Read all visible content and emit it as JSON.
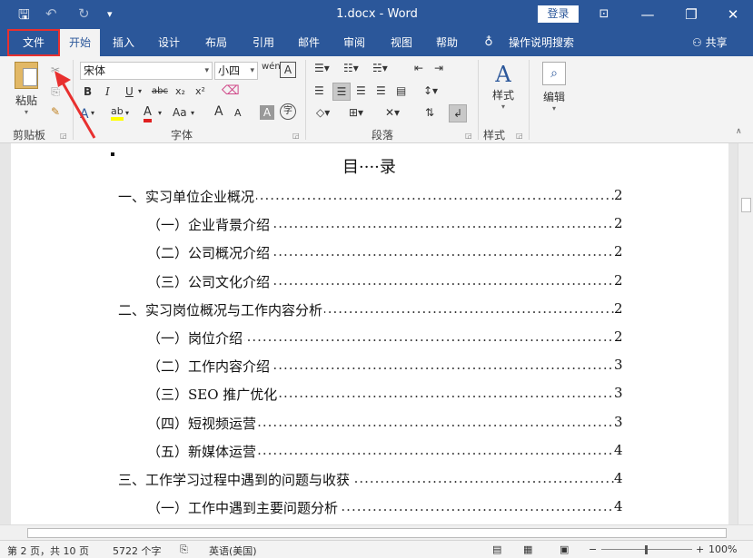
{
  "window": {
    "title": "1.docx  -  Word",
    "login_label": "登录",
    "minimize_icon": "—",
    "restore_icon": "❐",
    "close_icon": "✕"
  },
  "quick_access": {
    "save_icon": "🖫",
    "undo_icon": "↶",
    "redo_icon": "↻",
    "customize_icon": "▾"
  },
  "tabs": [
    {
      "label": "文件"
    },
    {
      "label": "开始"
    },
    {
      "label": "插入"
    },
    {
      "label": "设计"
    },
    {
      "label": "布局"
    },
    {
      "label": "引用"
    },
    {
      "label": "邮件"
    },
    {
      "label": "审阅"
    },
    {
      "label": "视图"
    },
    {
      "label": "帮助"
    },
    {
      "label": "操作说明搜索"
    }
  ],
  "share_label": "共享",
  "ribbon": {
    "clipboard": {
      "paste_label": "粘贴",
      "group_label": "剪贴板"
    },
    "font": {
      "font_name": "宋体",
      "font_size": "小四",
      "group_label": "字体",
      "bold": "B",
      "italic": "I",
      "underline": "U",
      "strike": "abc",
      "subscript": "x₂",
      "superscript": "x²",
      "change_case": "Aa",
      "grow": "A",
      "shrink": "A",
      "highlight": "ab",
      "font_color": "A"
    },
    "paragraph": {
      "group_label": "段落"
    },
    "styles": {
      "label": "样式",
      "group_label": "样式"
    },
    "editing": {
      "label": "编辑"
    }
  },
  "document": {
    "title": "目····录",
    "toc": [
      {
        "text": "一、实习单位企业概况",
        "page": "2",
        "indent": 0
      },
      {
        "text": "（一）企业背景介绍",
        "page": "2",
        "indent": 1
      },
      {
        "text": "（二）公司概况介绍",
        "page": "2",
        "indent": 1
      },
      {
        "text": "（三）公司文化介绍",
        "page": "2",
        "indent": 1
      },
      {
        "text": "二、实习岗位概况与工作内容分析",
        "page": "2",
        "indent": 0
      },
      {
        "text": "（一）岗位介绍",
        "page": "2",
        "indent": 1
      },
      {
        "text": "（二）工作内容介绍",
        "page": "3",
        "indent": 1
      },
      {
        "text": "（三）SEO 推广优化",
        "page": "3",
        "indent": 1
      },
      {
        "text": "（四）短视频运营",
        "page": "3",
        "indent": 1
      },
      {
        "text": "（五）新媒体运营",
        "page": "4",
        "indent": 1
      },
      {
        "text": "三、工作学习过程中遇到的问题与收获",
        "page": "4",
        "indent": 0
      },
      {
        "text": "（一）工作中遇到主要问题分析",
        "page": "4",
        "indent": 1
      }
    ]
  },
  "status": {
    "page": "第 2 页，共 10 页",
    "words": "5722 个字",
    "language": "英语(美国)",
    "zoom": "100%"
  },
  "colors": {
    "accent": "#2b579a",
    "highlight_box": "#e8302f"
  }
}
